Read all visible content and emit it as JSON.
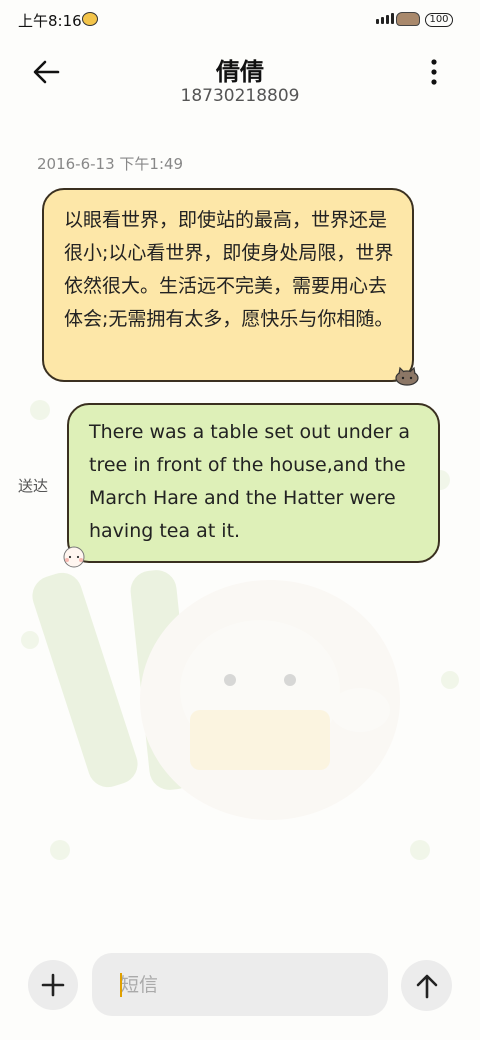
{
  "status_bar": {
    "time": "上午8:16",
    "battery": "100"
  },
  "header": {
    "contact_name": "倩倩",
    "contact_number": "18730218809"
  },
  "conversation": {
    "timestamp": "2016-6-13 下午1:49",
    "incoming_message": "以眼看世界，即使站的最高，世界还是很小;以心看世界，即使身处局限，世界依然很大。生活远不完美，需要用心去体会;无需拥有太多，愿快乐与你相随。",
    "outgoing_message": "There was a table set out under a tree in front of the house,and the March Hare and the Hatter were having tea at it.",
    "sent_status": "送达"
  },
  "input_bar": {
    "placeholder": "短信"
  },
  "colors": {
    "incoming_bubble": "#fde7a8",
    "outgoing_bubble": "#def0b8",
    "caret": "#e0a000"
  }
}
